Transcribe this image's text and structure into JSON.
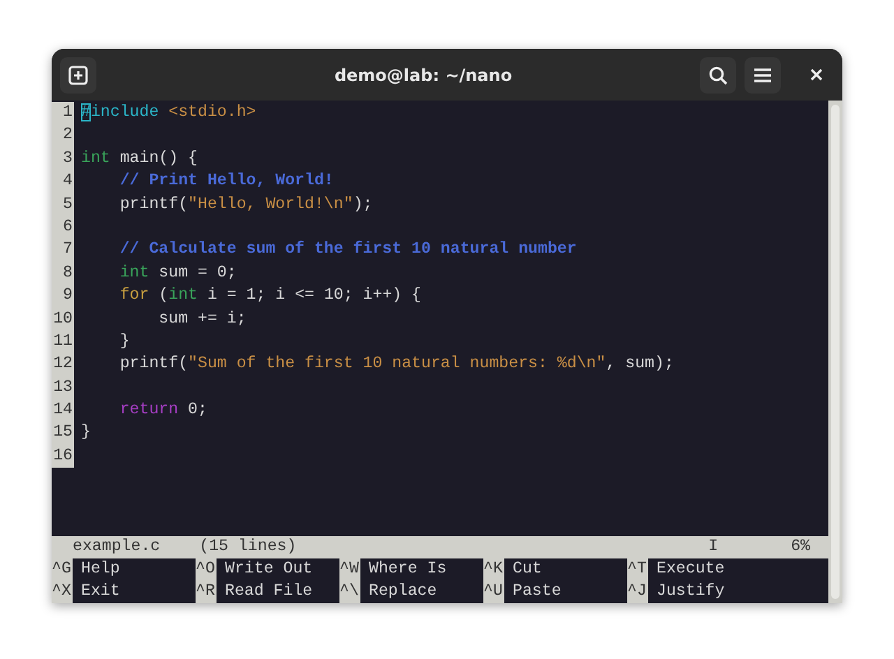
{
  "window": {
    "title": "demo@lab: ~/nano"
  },
  "editor": {
    "lines": [
      {
        "number": "1",
        "tokens": [
          {
            "text": "#",
            "kind": "cursor"
          },
          {
            "text": "include ",
            "kind": "preproc"
          },
          {
            "text": "<stdio.h>",
            "kind": "string"
          }
        ]
      },
      {
        "number": "2"
      },
      {
        "number": "3",
        "tokens": [
          {
            "text": "int",
            "kind": "type"
          },
          {
            "text": " main() {",
            "kind": "plain"
          }
        ]
      },
      {
        "number": "4",
        "tokens": [
          {
            "text": "    // Print Hello, World!",
            "kind": "comment"
          }
        ]
      },
      {
        "number": "5",
        "tokens": [
          {
            "text": "    printf(",
            "kind": "plain"
          },
          {
            "text": "\"Hello, World!\\n\"",
            "kind": "string"
          },
          {
            "text": ");",
            "kind": "plain"
          }
        ]
      },
      {
        "number": "6"
      },
      {
        "number": "7",
        "tokens": [
          {
            "text": "    // Calculate sum of the first 10 natural number",
            "kind": "comment"
          }
        ]
      },
      {
        "number": "8",
        "tokens": [
          {
            "text": "    int",
            "kind": "type"
          },
          {
            "text": " sum = 0;",
            "kind": "plain"
          }
        ]
      },
      {
        "number": "9",
        "tokens": [
          {
            "text": "    for",
            "kind": "keyword"
          },
          {
            "text": " (",
            "kind": "plain"
          },
          {
            "text": "int",
            "kind": "type"
          },
          {
            "text": " i = 1; i <= 10; i++) {",
            "kind": "plain"
          }
        ]
      },
      {
        "number": "10",
        "tokens": [
          {
            "text": "        sum += i;",
            "kind": "plain"
          }
        ]
      },
      {
        "number": "11",
        "tokens": [
          {
            "text": "    }",
            "kind": "plain"
          }
        ]
      },
      {
        "number": "12",
        "tokens": [
          {
            "text": "    printf(",
            "kind": "plain"
          },
          {
            "text": "\"Sum of the first 10 natural numbers: %d\\n\"",
            "kind": "string"
          },
          {
            "text": ", sum);",
            "kind": "plain"
          }
        ]
      },
      {
        "number": "13"
      },
      {
        "number": "14",
        "tokens": [
          {
            "text": "    return",
            "kind": "flow"
          },
          {
            "text": " 0;",
            "kind": "plain"
          }
        ]
      },
      {
        "number": "15",
        "tokens": [
          {
            "text": "}",
            "kind": "plain"
          }
        ]
      },
      {
        "number": "16"
      }
    ]
  },
  "status_bar": {
    "filename": "example.c",
    "info": "(15 lines)",
    "mode": "I",
    "percent": "6%"
  },
  "shortcuts": [
    [
      {
        "key": "^G",
        "label": "Help"
      },
      {
        "key": "^O",
        "label": "Write Out"
      },
      {
        "key": "^W",
        "label": "Where Is"
      },
      {
        "key": "^K",
        "label": "Cut"
      },
      {
        "key": "^T",
        "label": "Execute"
      }
    ],
    [
      {
        "key": "^X",
        "label": "Exit"
      },
      {
        "key": "^R",
        "label": "Read File"
      },
      {
        "key": "^\\",
        "label": "Replace"
      },
      {
        "key": "^U",
        "label": "Paste"
      },
      {
        "key": "^J",
        "label": "Justify"
      }
    ]
  ]
}
